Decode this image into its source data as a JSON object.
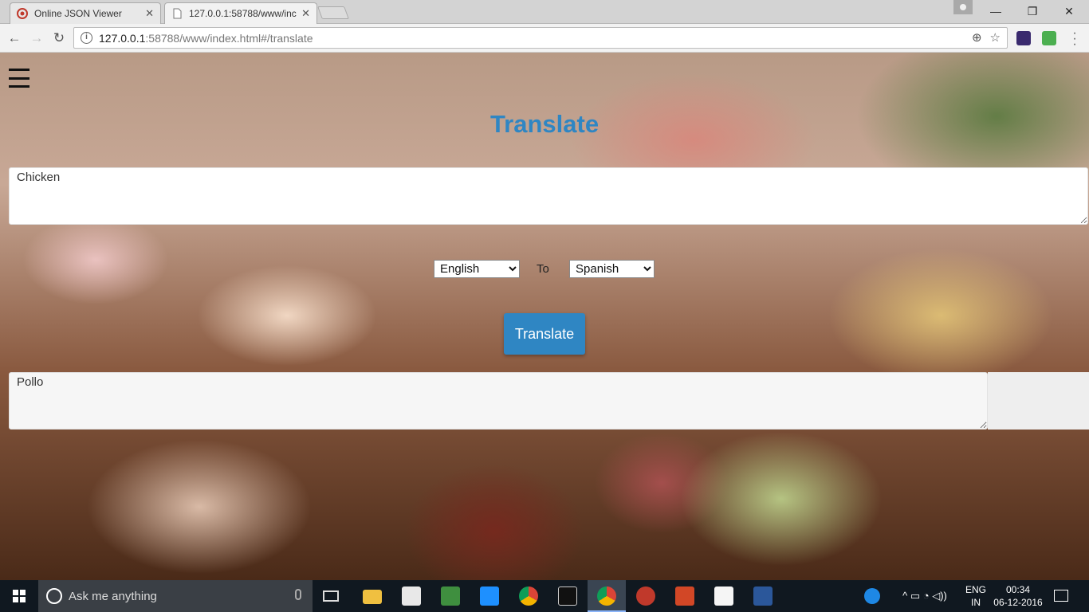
{
  "browser": {
    "tabs": [
      {
        "title": "Online JSON Viewer",
        "close": "✕"
      },
      {
        "title": "127.0.0.1:58788/www/inc",
        "close": "✕"
      }
    ],
    "address": {
      "host": "127.0.0.1",
      "rest": ":58788/www/index.html#/translate"
    },
    "window_controls": {
      "minimize": "—",
      "maximize": "❐",
      "close": "✕"
    },
    "nav": {
      "back": "←",
      "forward": "→",
      "reload": "↻"
    },
    "omni_icons": {
      "zoom": "⊕",
      "star": "☆"
    }
  },
  "page": {
    "menu_icon": "hamburger-icon",
    "title": "Translate",
    "source_text": "Chicken",
    "from_language": "English",
    "to_label": "To",
    "to_language": "Spanish",
    "button_label": "Translate",
    "result_text": "Pollo"
  },
  "taskbar": {
    "search_placeholder": "Ask me anything",
    "language": {
      "line1": "ENG",
      "line2": "IN"
    },
    "clock": {
      "time": "00:34",
      "date": "06-12-2016"
    },
    "tray_icons": "^ ▭ ◔ ◁))"
  },
  "colors": {
    "accent": "#2f86c3",
    "taskbar": "#101820"
  }
}
